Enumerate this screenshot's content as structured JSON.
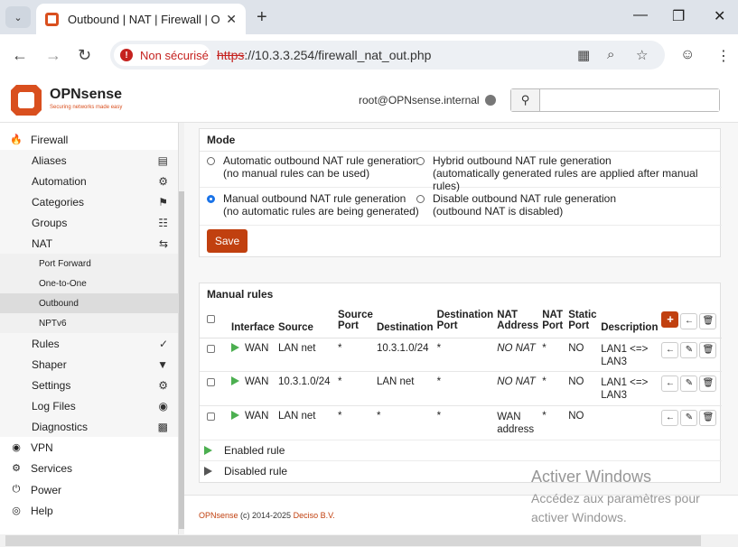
{
  "browser": {
    "tab_title": "Outbound | NAT | Firewall | OPN",
    "security_label": "Non sécurisé",
    "url_protocol": "https",
    "url_rest": "://10.3.3.254/firewall_nat_out.php"
  },
  "header": {
    "brand": "OPNsense",
    "tagline": "Securing networks made easy",
    "user": "root@OPNsense.internal",
    "search_placeholder": ""
  },
  "sidebar": {
    "top_label": "Firewall",
    "items": [
      {
        "label": "Aliases",
        "icon": "list-icon"
      },
      {
        "label": "Automation",
        "icon": "gear-icon"
      },
      {
        "label": "Categories",
        "icon": "tags-icon"
      },
      {
        "label": "Groups",
        "icon": "sitemap-icon"
      },
      {
        "label": "NAT",
        "icon": "exchange-icon"
      },
      {
        "label": "Port Forward"
      },
      {
        "label": "One-to-One"
      },
      {
        "label": "Outbound"
      },
      {
        "label": "NPTv6"
      },
      {
        "label": "Rules",
        "icon": "check-icon"
      },
      {
        "label": "Shaper",
        "icon": "filter-icon"
      },
      {
        "label": "Settings",
        "icon": "cogs-icon"
      },
      {
        "label": "Log Files",
        "icon": "eye-icon"
      },
      {
        "label": "Diagnostics",
        "icon": "medkit-icon"
      }
    ],
    "bottom": [
      {
        "label": "VPN",
        "icon": "globe-icon"
      },
      {
        "label": "Services",
        "icon": "gear-icon"
      },
      {
        "label": "Power",
        "icon": "plug-icon"
      },
      {
        "label": "Help",
        "icon": "life-ring-icon"
      }
    ]
  },
  "mode": {
    "title": "Mode",
    "options": [
      {
        "line1": "Automatic outbound NAT rule generation",
        "line2": "(no manual rules can be used)",
        "selected": false
      },
      {
        "line1": "Hybrid outbound NAT rule generation",
        "line2": "(automatically generated rules are applied after manual rules)",
        "selected": false
      },
      {
        "line1": "Manual outbound NAT rule generation",
        "line2": "(no automatic rules are being generated)",
        "selected": true
      },
      {
        "line1": "Disable outbound NAT rule generation",
        "line2": "(outbound NAT is disabled)",
        "selected": false
      }
    ],
    "save_label": "Save"
  },
  "rules": {
    "title": "Manual rules",
    "headers": {
      "interface": "Interface",
      "source": "Source",
      "source_port_1": "Source",
      "source_port_2": "Port",
      "destination": "Destination",
      "dest_port_1": "Destination",
      "dest_port_2": "Port",
      "nat_address_1": "NAT",
      "nat_address_2": "Address",
      "nat_port_1": "NAT",
      "nat_port_2": "Port",
      "static_port_1": "Static",
      "static_port_2": "Port",
      "description": "Description"
    },
    "rows": [
      {
        "interface": "WAN",
        "source": "LAN net",
        "source_port": "*",
        "destination": "10.3.1.0/24",
        "dest_port": "*",
        "nat_address": "NO NAT",
        "nat_port": "*",
        "static_port": "NO",
        "desc1": "LAN1 <=>",
        "desc2": "LAN3"
      },
      {
        "interface": "WAN",
        "source": "10.3.1.0/24",
        "source_port": "*",
        "destination": "LAN net",
        "dest_port": "*",
        "nat_address": "NO NAT",
        "nat_port": "*",
        "static_port": "NO",
        "desc1": "LAN1 <=>",
        "desc2": "LAN3"
      },
      {
        "interface": "WAN",
        "source": "LAN net",
        "source_port": "*",
        "destination": "*",
        "dest_port": "*",
        "nat_address": "WAN",
        "nat_address2": "address",
        "nat_port": "*",
        "static_port": "NO",
        "desc1": "",
        "desc2": ""
      }
    ],
    "legend_enabled": "Enabled rule",
    "legend_disabled": "Disabled rule"
  },
  "footer": {
    "brand": "OPNsense",
    "copyright": " (c) 2014-2025 ",
    "company": "Deciso B.V."
  },
  "watermark": {
    "line1": "Activer Windows",
    "line2": "Accédez aux paramètres pour",
    "line3": "activer Windows."
  },
  "colors": {
    "accent": "#c1400f",
    "enabled": "#4caf50",
    "radio_selected": "#1a73e8"
  }
}
